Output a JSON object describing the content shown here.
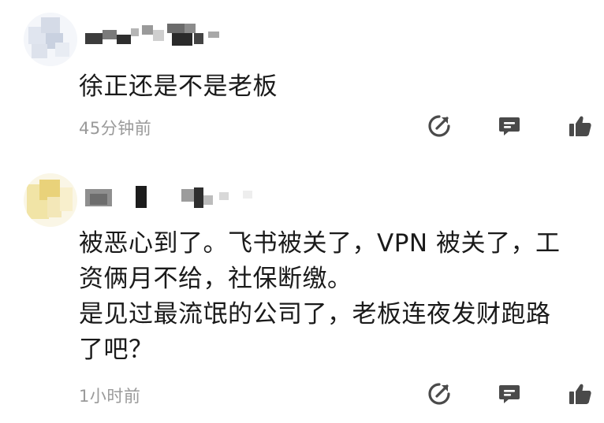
{
  "comments": [
    {
      "content_lines": [
        "徐正还是不是老板"
      ],
      "timestamp": "45分钟前"
    },
    {
      "content_lines": [
        "被恶心到了。飞书被关了，VPN 被关了，工",
        "资俩月不给，社保断缴。",
        "是见过最流氓的公司了，老板连夜发财跑路",
        "了吧？"
      ],
      "timestamp": "1小时前"
    }
  ],
  "icons": {
    "share": "share-icon",
    "reply": "comment-icon",
    "like": "thumbs-up-icon"
  },
  "colors": {
    "text": "#1a1a1a",
    "meta": "#9a9a9a",
    "icon": "#4a4a4a"
  }
}
